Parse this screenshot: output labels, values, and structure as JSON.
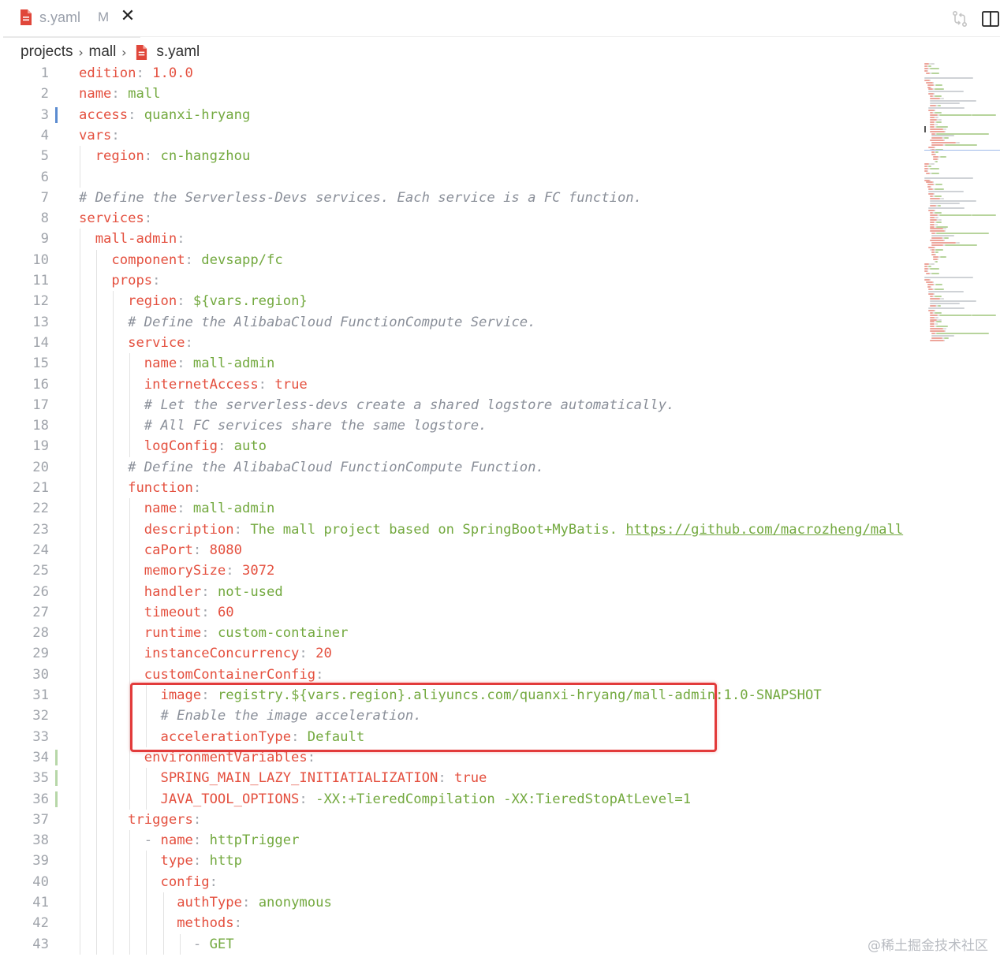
{
  "tab": {
    "title": "s.yaml",
    "badge": "M",
    "close_glyph": "✕",
    "icon": "yaml-file-icon"
  },
  "breadcrumb": [
    "projects",
    "mall",
    "s.yaml"
  ],
  "colors": {
    "key": "#e4503f",
    "string": "#73a93f",
    "number": "#e4503f",
    "comment": "#8a8f99",
    "line_number": "#a0a4ab",
    "modified_gutter": "#5b8bd0",
    "added_gutter": "#b7d7a8",
    "highlight_box": "#e23b3b",
    "file_icon": "#e0463a"
  },
  "toolbar_icons": [
    "compare-changes-icon",
    "split-editor-icon"
  ],
  "lines": [
    {
      "num": "1",
      "indent": "",
      "tokens": [
        {
          "t": "k",
          "v": "edition"
        },
        {
          "t": "p",
          "v": ": "
        },
        {
          "t": "n",
          "v": "1.0.0"
        }
      ]
    },
    {
      "num": "2",
      "indent": "",
      "tokens": [
        {
          "t": "k",
          "v": "name"
        },
        {
          "t": "p",
          "v": ": "
        },
        {
          "t": "s",
          "v": "mall"
        }
      ]
    },
    {
      "num": "3",
      "indent": "",
      "tokens": [
        {
          "t": "k",
          "v": "access"
        },
        {
          "t": "p",
          "v": ": "
        },
        {
          "t": "s",
          "v": "quanxi-hryang"
        }
      ]
    },
    {
      "num": "4",
      "indent": "",
      "tokens": [
        {
          "t": "k",
          "v": "vars"
        },
        {
          "t": "p",
          "v": ":"
        }
      ]
    },
    {
      "num": "5",
      "indent": "  ",
      "tokens": [
        {
          "t": "k",
          "v": "region"
        },
        {
          "t": "p",
          "v": ": "
        },
        {
          "t": "s",
          "v": "cn-hangzhou"
        }
      ]
    },
    {
      "num": "6",
      "indent": "",
      "tokens": []
    },
    {
      "num": "7",
      "indent": "",
      "tokens": [
        {
          "t": "c",
          "v": "# Define the Serverless-Devs services. Each service is a FC function."
        }
      ]
    },
    {
      "num": "8",
      "indent": "",
      "tokens": [
        {
          "t": "k",
          "v": "services"
        },
        {
          "t": "p",
          "v": ":"
        }
      ]
    },
    {
      "num": "9",
      "indent": "  ",
      "tokens": [
        {
          "t": "k",
          "v": "mall-admin"
        },
        {
          "t": "p",
          "v": ":"
        }
      ]
    },
    {
      "num": "10",
      "indent": "    ",
      "tokens": [
        {
          "t": "k",
          "v": "component"
        },
        {
          "t": "p",
          "v": ": "
        },
        {
          "t": "s",
          "v": "devsapp/fc"
        }
      ]
    },
    {
      "num": "11",
      "indent": "    ",
      "tokens": [
        {
          "t": "k",
          "v": "props"
        },
        {
          "t": "p",
          "v": ":"
        }
      ]
    },
    {
      "num": "12",
      "indent": "      ",
      "tokens": [
        {
          "t": "k",
          "v": "region"
        },
        {
          "t": "p",
          "v": ": "
        },
        {
          "t": "s",
          "v": "${vars.region}"
        }
      ]
    },
    {
      "num": "13",
      "indent": "      ",
      "tokens": [
        {
          "t": "c",
          "v": "# Define the AlibabaCloud FunctionCompute Service."
        }
      ]
    },
    {
      "num": "14",
      "indent": "      ",
      "tokens": [
        {
          "t": "k",
          "v": "service"
        },
        {
          "t": "p",
          "v": ":"
        }
      ]
    },
    {
      "num": "15",
      "indent": "        ",
      "tokens": [
        {
          "t": "k",
          "v": "name"
        },
        {
          "t": "p",
          "v": ": "
        },
        {
          "t": "s",
          "v": "mall-admin"
        }
      ]
    },
    {
      "num": "16",
      "indent": "        ",
      "tokens": [
        {
          "t": "k",
          "v": "internetAccess"
        },
        {
          "t": "p",
          "v": ": "
        },
        {
          "t": "n",
          "v": "true"
        }
      ]
    },
    {
      "num": "17",
      "indent": "        ",
      "tokens": [
        {
          "t": "c",
          "v": "# Let the serverless-devs create a shared logstore automatically."
        }
      ]
    },
    {
      "num": "18",
      "indent": "        ",
      "tokens": [
        {
          "t": "c",
          "v": "# All FC services share the same logstore."
        }
      ]
    },
    {
      "num": "19",
      "indent": "        ",
      "tokens": [
        {
          "t": "k",
          "v": "logConfig"
        },
        {
          "t": "p",
          "v": ": "
        },
        {
          "t": "s",
          "v": "auto"
        }
      ]
    },
    {
      "num": "20",
      "indent": "      ",
      "tokens": [
        {
          "t": "c",
          "v": "# Define the AlibabaCloud FunctionCompute Function."
        }
      ]
    },
    {
      "num": "21",
      "indent": "      ",
      "tokens": [
        {
          "t": "k",
          "v": "function"
        },
        {
          "t": "p",
          "v": ":"
        }
      ]
    },
    {
      "num": "22",
      "indent": "        ",
      "tokens": [
        {
          "t": "k",
          "v": "name"
        },
        {
          "t": "p",
          "v": ": "
        },
        {
          "t": "s",
          "v": "mall-admin"
        }
      ]
    },
    {
      "num": "23",
      "indent": "        ",
      "tokens": [
        {
          "t": "k",
          "v": "description"
        },
        {
          "t": "p",
          "v": ": "
        },
        {
          "t": "s",
          "v": "The mall project based on SpringBoot+MyBatis. "
        },
        {
          "t": "u",
          "v": "https://github.com/macrozheng/mall"
        }
      ]
    },
    {
      "num": "24",
      "indent": "        ",
      "tokens": [
        {
          "t": "k",
          "v": "caPort"
        },
        {
          "t": "p",
          "v": ": "
        },
        {
          "t": "n",
          "v": "8080"
        }
      ]
    },
    {
      "num": "25",
      "indent": "        ",
      "tokens": [
        {
          "t": "k",
          "v": "memorySize"
        },
        {
          "t": "p",
          "v": ": "
        },
        {
          "t": "n",
          "v": "3072"
        }
      ]
    },
    {
      "num": "26",
      "indent": "        ",
      "tokens": [
        {
          "t": "k",
          "v": "handler"
        },
        {
          "t": "p",
          "v": ": "
        },
        {
          "t": "s",
          "v": "not-used"
        }
      ]
    },
    {
      "num": "27",
      "indent": "        ",
      "tokens": [
        {
          "t": "k",
          "v": "timeout"
        },
        {
          "t": "p",
          "v": ": "
        },
        {
          "t": "n",
          "v": "60"
        }
      ]
    },
    {
      "num": "28",
      "indent": "        ",
      "tokens": [
        {
          "t": "k",
          "v": "runtime"
        },
        {
          "t": "p",
          "v": ": "
        },
        {
          "t": "s",
          "v": "custom-container"
        }
      ]
    },
    {
      "num": "29",
      "indent": "        ",
      "tokens": [
        {
          "t": "k",
          "v": "instanceConcurrency"
        },
        {
          "t": "p",
          "v": ": "
        },
        {
          "t": "n",
          "v": "20"
        }
      ]
    },
    {
      "num": "30",
      "indent": "        ",
      "tokens": [
        {
          "t": "k",
          "v": "customContainerConfig"
        },
        {
          "t": "p",
          "v": ":"
        }
      ]
    },
    {
      "num": "31",
      "indent": "          ",
      "tokens": [
        {
          "t": "k",
          "v": "image"
        },
        {
          "t": "p",
          "v": ": "
        },
        {
          "t": "s",
          "v": "registry.${vars.region}.aliyuncs.com/quanxi-hryang/mall-admin:1.0-SNAPSHOT"
        }
      ]
    },
    {
      "num": "32",
      "indent": "          ",
      "tokens": [
        {
          "t": "c",
          "v": "# Enable the image acceleration."
        }
      ]
    },
    {
      "num": "33",
      "indent": "          ",
      "tokens": [
        {
          "t": "k",
          "v": "accelerationType"
        },
        {
          "t": "p",
          "v": ": "
        },
        {
          "t": "s",
          "v": "Default"
        }
      ]
    },
    {
      "num": "34",
      "indent": "        ",
      "tokens": [
        {
          "t": "k",
          "v": "environmentVariables"
        },
        {
          "t": "p",
          "v": ":"
        }
      ]
    },
    {
      "num": "35",
      "indent": "          ",
      "tokens": [
        {
          "t": "k",
          "v": "SPRING_MAIN_LAZY_INITIATIALIZATION"
        },
        {
          "t": "p",
          "v": ": "
        },
        {
          "t": "n",
          "v": "true"
        }
      ]
    },
    {
      "num": "36",
      "indent": "          ",
      "tokens": [
        {
          "t": "k",
          "v": "JAVA_TOOL_OPTIONS"
        },
        {
          "t": "p",
          "v": ": "
        },
        {
          "t": "s",
          "v": "-XX:+TieredCompilation -XX:TieredStopAtLevel=1"
        }
      ]
    },
    {
      "num": "37",
      "indent": "      ",
      "tokens": [
        {
          "t": "k",
          "v": "triggers"
        },
        {
          "t": "p",
          "v": ":"
        }
      ]
    },
    {
      "num": "38",
      "indent": "        ",
      "tokens": [
        {
          "t": "p",
          "v": "- "
        },
        {
          "t": "k",
          "v": "name"
        },
        {
          "t": "p",
          "v": ": "
        },
        {
          "t": "s",
          "v": "httpTrigger"
        }
      ]
    },
    {
      "num": "39",
      "indent": "          ",
      "tokens": [
        {
          "t": "k",
          "v": "type"
        },
        {
          "t": "p",
          "v": ": "
        },
        {
          "t": "s",
          "v": "http"
        }
      ]
    },
    {
      "num": "40",
      "indent": "          ",
      "tokens": [
        {
          "t": "k",
          "v": "config"
        },
        {
          "t": "p",
          "v": ":"
        }
      ]
    },
    {
      "num": "41",
      "indent": "            ",
      "tokens": [
        {
          "t": "k",
          "v": "authType"
        },
        {
          "t": "p",
          "v": ": "
        },
        {
          "t": "s",
          "v": "anonymous"
        }
      ]
    },
    {
      "num": "42",
      "indent": "            ",
      "tokens": [
        {
          "t": "k",
          "v": "methods"
        },
        {
          "t": "p",
          "v": ":"
        }
      ]
    },
    {
      "num": "43",
      "indent": "              ",
      "tokens": [
        {
          "t": "p",
          "v": "- "
        },
        {
          "t": "s",
          "v": "GET"
        }
      ]
    }
  ],
  "watermark": "@稀土掘金技术社区"
}
